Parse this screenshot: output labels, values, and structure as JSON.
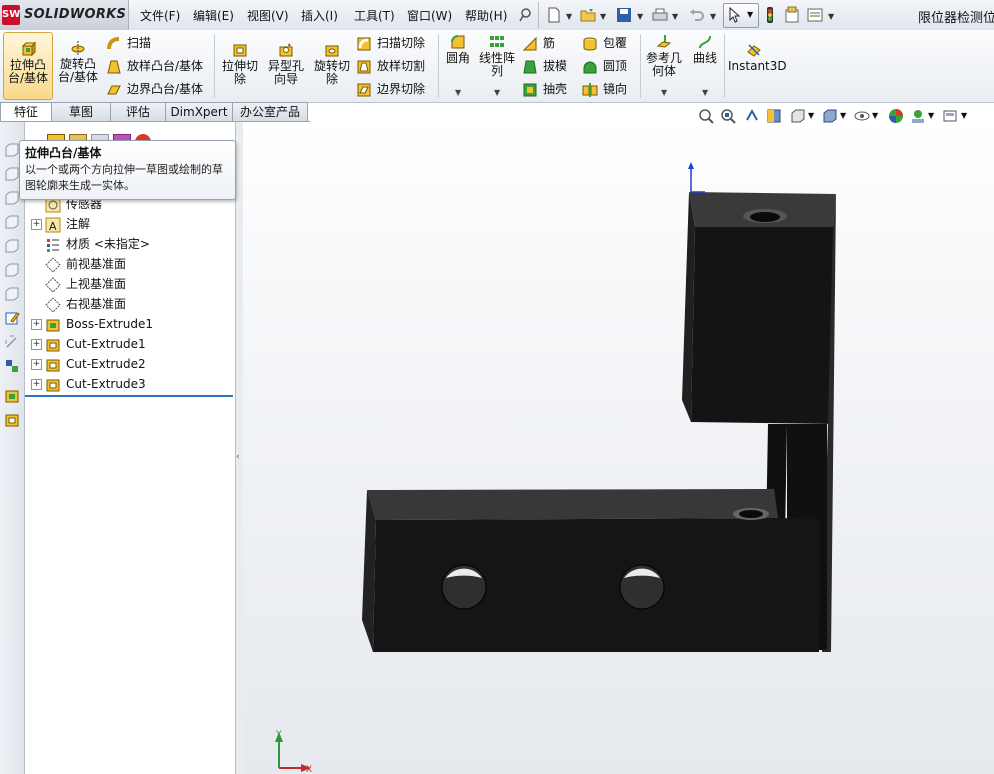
{
  "app": {
    "name": "SOLIDWORKS",
    "logo_badge": "SW",
    "document_title": "限位器检测位:"
  },
  "menu": [
    "文件(F)",
    "编辑(E)",
    "视图(V)",
    "插入(I)",
    "工具(T)",
    "窗口(W)",
    "帮助(H)"
  ],
  "quick_access": [
    {
      "icon": "pin-icon"
    },
    {
      "icon": "new-document-icon"
    },
    {
      "icon": "open-icon"
    },
    {
      "icon": "save-icon"
    },
    {
      "icon": "print-icon"
    },
    {
      "icon": "undo-icon"
    },
    {
      "icon": "select-arrow-icon"
    },
    {
      "icon": "rebuild-traffic-light-icon"
    },
    {
      "icon": "file-properties-icon"
    },
    {
      "icon": "options-icon"
    }
  ],
  "commands": {
    "extrude_boss": "拉伸凸台/基体",
    "revolve_boss": "旋转凸台/基体",
    "sweep": "扫描",
    "loft": "放样凸台/基体",
    "boundary_boss": "边界凸台/基体",
    "extrude_cut": "拉伸切除",
    "hole_wizard": "异型孔向导",
    "revolve_cut": "旋转切除",
    "swept_cut": "扫描切除",
    "lofted_cut": "放样切割",
    "boundary_cut": "边界切除",
    "fillet": "圆角",
    "linear_pattern": "线性阵列",
    "rib": "筋",
    "draft": "拔模",
    "shell": "抽壳",
    "wrap": "包覆",
    "dome": "圆顶",
    "mirror": "镜向",
    "reference_geometry": "参考几何体",
    "curves": "曲线",
    "instant3d": "Instant3D"
  },
  "tabs": [
    "特征",
    "草图",
    "评估",
    "DimXpert",
    "办公室产品"
  ],
  "active_tab": 0,
  "tooltip": {
    "title": "拉伸凸台/基体",
    "description": "以一个或两个方向拉伸一草图或绘制的草图轮廓来生成一实体。"
  },
  "tree": [
    {
      "label": "传感器",
      "icon": "sensor-icon",
      "expandable": false
    },
    {
      "label": "注解",
      "icon": "annotations-icon",
      "expandable": true
    },
    {
      "label": "材质 <未指定>",
      "icon": "material-icon",
      "expandable": false
    },
    {
      "label": "前视基准面",
      "icon": "plane-icon",
      "expandable": false
    },
    {
      "label": "上视基准面",
      "icon": "plane-icon",
      "expandable": false
    },
    {
      "label": "右视基准面",
      "icon": "plane-icon",
      "expandable": false
    },
    {
      "label": "Boss-Extrude1",
      "icon": "boss-extrude-icon",
      "expandable": true
    },
    {
      "label": "Cut-Extrude1",
      "icon": "cut-extrude-icon",
      "expandable": true
    },
    {
      "label": "Cut-Extrude2",
      "icon": "cut-extrude-icon",
      "expandable": true
    },
    {
      "label": "Cut-Extrude3",
      "icon": "cut-extrude-icon",
      "expandable": true
    }
  ],
  "triad": {
    "y_label": "Y",
    "x_label": "X"
  },
  "colors": {
    "part": "#151515",
    "accent": "#e7b93a",
    "origin": "#1f3fd6"
  }
}
